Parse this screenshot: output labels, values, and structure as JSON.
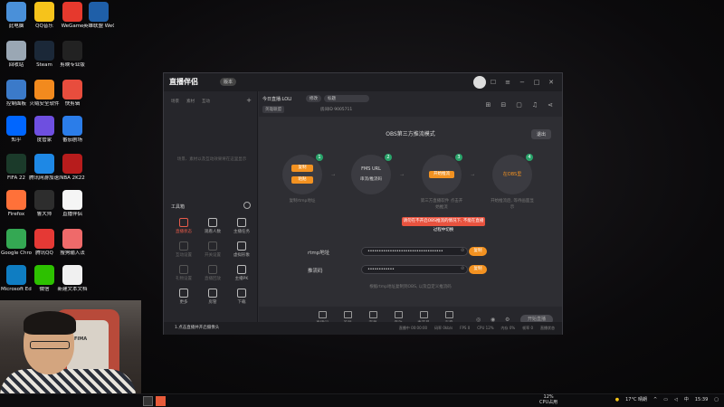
{
  "desktop_icons": [
    {
      "label": "此电脑",
      "color": "#4a90d9"
    },
    {
      "label": "QQ音乐",
      "color": "#f6c31b"
    },
    {
      "label": "WeGame",
      "color": "#e6392d"
    },
    {
      "label": "英雄联盟 WeGame版",
      "color": "#1f5fa8"
    },
    {
      "label": "回收站",
      "color": "#9aa7b4"
    },
    {
      "label": "Steam",
      "color": "#1b2838"
    },
    {
      "label": "剪映专业版",
      "color": "#222"
    },
    {
      "label": "控制面板",
      "color": "#3b7ac9"
    },
    {
      "label": "火绒安全软件",
      "color": "#f28a1e"
    },
    {
      "label": "快剪辑",
      "color": "#e84d3d"
    },
    {
      "label": "知乎",
      "color": "#0066ff"
    },
    {
      "label": "度管家",
      "color": "#6e4fe0"
    },
    {
      "label": "番茄剧场",
      "color": "#2b7de9"
    },
    {
      "label": "FIFA 22",
      "color": "#1b3a2a"
    },
    {
      "label": "腾讯网游加速器5.0",
      "color": "#1e88e5"
    },
    {
      "label": "NBA 2K22",
      "color": "#b71c1c"
    },
    {
      "label": "Firefox",
      "color": "#ff7139"
    },
    {
      "label": "鲁大师",
      "color": "#2d2d2d"
    },
    {
      "label": "直播伴侣",
      "color": "#f5f5f5"
    },
    {
      "label": "Google Chrome",
      "color": "#34a853"
    },
    {
      "label": "腾讯QQ",
      "color": "#e53935"
    },
    {
      "label": "搜狗输入法",
      "color": "#ef6a6a"
    },
    {
      "label": "Microsoft Edge",
      "color": "#0f7dc2"
    },
    {
      "label": "微信",
      "color": "#2dc100"
    },
    {
      "label": "新建文本文档",
      "color": "#f0f0f0"
    }
  ],
  "window": {
    "app_title": "直播伴侣",
    "version": "版本",
    "sidebar": {
      "tabs": [
        "场景",
        "素材",
        "互动"
      ],
      "empty_text": "场景、素材以及互动效果将在这里显示",
      "tools_title": "工具箱",
      "tools": [
        {
          "label": "直播状态",
          "active": true
        },
        {
          "label": "观看人数"
        },
        {
          "label": "主播任务"
        },
        {
          "label": "互动设置",
          "dim": true
        },
        {
          "label": "开关设置",
          "dim": true
        },
        {
          "label": "虚拟形象"
        },
        {
          "label": "礼物设置",
          "dim": true
        },
        {
          "label": "直播回放",
          "dim": true
        },
        {
          "label": "主播PK"
        },
        {
          "label": "更多"
        },
        {
          "label": "房管"
        },
        {
          "label": "下载"
        }
      ]
    },
    "info": {
      "today_label": "今日直播:LOLI",
      "edit_btn": "修改",
      "topic_btn": "标题",
      "category": "英雄联盟",
      "room_label": "房间ID 9005711"
    },
    "mode_title": "OBS第三方推流模式",
    "exit_btn": "退出",
    "steps": [
      {
        "num": "1",
        "lines": [
          "复制",
          "粘贴"
        ],
        "caption": "复制rtmp地址"
      },
      {
        "num": "2",
        "title": "FMS URL",
        "sub": "串流/推流码",
        "caption": ""
      },
      {
        "num": "3",
        "pill": "开始推流",
        "caption": "第三方直播软件 点击开始推流"
      },
      {
        "num": "4",
        "title": "在OBS里",
        "caption": "开始推流后, 等待画面显示"
      }
    ],
    "tooltip": "请勿在不开启OBS推流的情况下, 不能在直播过程中切换",
    "fields": [
      {
        "label": "rtmp地址",
        "value": "••••••••••••••••••••••••••••••••••",
        "btn": "复制"
      },
      {
        "label": "推流码",
        "value": "••••••••••••",
        "btn": "复制"
      }
    ],
    "hint": "根据rtmp地址复制到OBS, 以及自定义推流码",
    "bottom_items": [
      "直播间",
      "美颜",
      "字幕",
      "音效",
      "麦克风",
      "声音"
    ],
    "start_btn": "开始直播",
    "status_left": "1.点击直播并开启摄像头",
    "status_right": [
      "直播中 00:00:00",
      "码率 0kb/s",
      "FPS 0",
      "CPU 12%",
      "内存 0%",
      "帧率 0",
      "直播状态"
    ]
  },
  "webcam": {
    "chair_text": "FIMA"
  },
  "taskbar": {
    "cpu_value": "12%",
    "cpu_label": "CPU占用",
    "weather": "17°C 晴朗",
    "time": "15:39"
  }
}
